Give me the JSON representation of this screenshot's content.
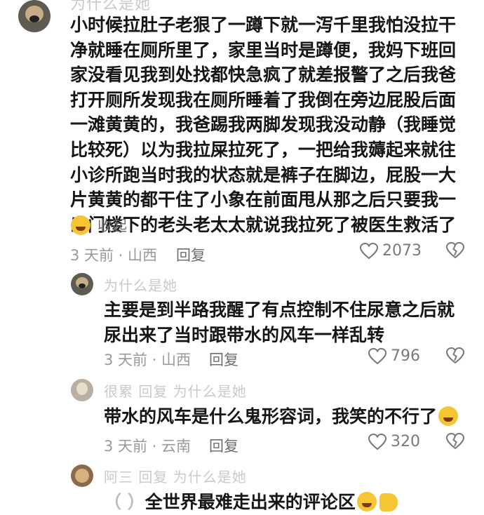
{
  "comments": [
    {
      "username": "为什么是她",
      "text": "小时候拉肚子老狠了一蹲下就一泻千里我怕没拉干净就睡在厕所里了，家里当时是蹲便，我妈下班回家没看见我到处找都快急疯了就差报警了之后我爸打开厕所发现我在厕所睡着了我倒在旁边屁股后面一滩黄黄的，我爸踢我两脚发现我没动静（我睡觉比较死）以为我拉屎拉死了，一把给我薅起来就往小诊所跑当时我的状态就是裤子在脚边，屁股一大片黄黄的都干住了小象在前面甩从那之后只要我一出门楼下的老头老太太就说我拉死了被医生救活了",
      "collapse_label": "收起",
      "meta": "3 天前 · 山西",
      "reply_label": "回复",
      "likes": "2073"
    },
    {
      "username": "为什么是她",
      "text": "主要是到半路我醒了有点控制不住尿意之后就尿出来了当时跟带水的风车一样乱转",
      "meta": "3 天前 · 山西",
      "reply_label": "回复",
      "likes": "796"
    },
    {
      "username": "很累 回复 为什么是她",
      "text": "带水的风车是什么鬼形容词，我笑的不行了",
      "meta": "3 天前 · 云南",
      "reply_label": "回复",
      "likes": "320"
    },
    {
      "username": "阿三 回复 为什么是她",
      "text_prefix": "（ ）",
      "text": "全世界最难走出来的评论区"
    }
  ],
  "colors": {
    "emoji": "#f6c533",
    "like_icon": "#777777"
  }
}
